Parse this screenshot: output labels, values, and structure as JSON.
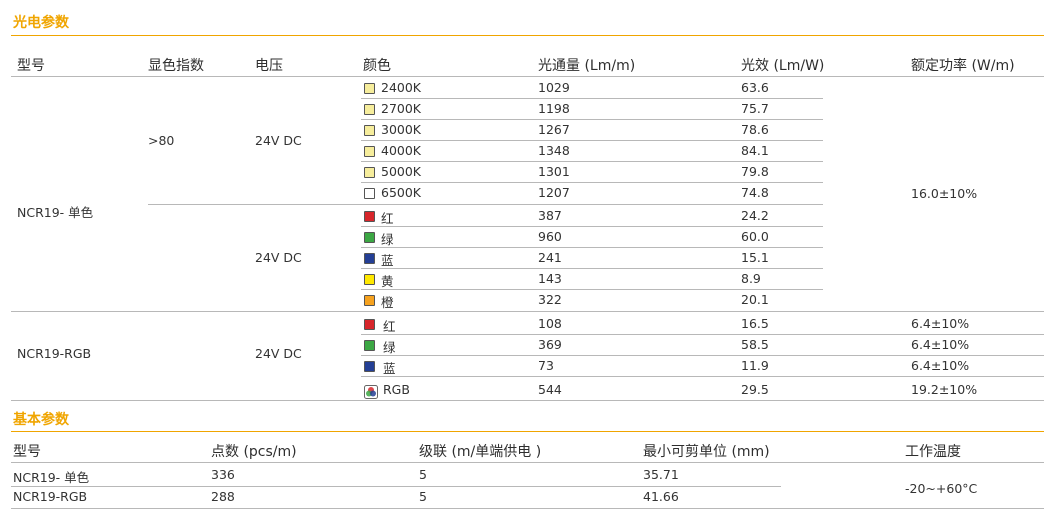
{
  "sections": {
    "optical": "光电参数",
    "basic": "基本参数"
  },
  "colors": {
    "accent": "#f0a500",
    "warm_white": "#f6ed9c",
    "cool_white": "#ffffff",
    "red": "#d7262b",
    "green": "#3ca744",
    "blue": "#243f95",
    "yellow": "#ffe800",
    "orange": "#f6a21e"
  },
  "optical_table": {
    "headers": [
      "型号",
      "显色指数",
      "电压",
      "颜色",
      "光通量 (Lm/m)",
      "光效 (Lm/W)",
      "额定功率 (W/m)"
    ],
    "mono": {
      "model": "NCR19- 单色",
      "cri": ">80",
      "voltage_white": "24V DC",
      "voltage_color": "24V DC",
      "power": "16.0±10%",
      "rows": [
        {
          "color": "2400K",
          "swatch": "warm_white",
          "flux": "1029",
          "efficacy": "63.6"
        },
        {
          "color": "2700K",
          "swatch": "warm_white",
          "flux": "1198",
          "efficacy": "75.7"
        },
        {
          "color": "3000K",
          "swatch": "warm_white",
          "flux": "1267",
          "efficacy": "78.6"
        },
        {
          "color": "4000K",
          "swatch": "warm_white",
          "flux": "1348",
          "efficacy": "84.1"
        },
        {
          "color": "5000K",
          "swatch": "warm_white",
          "flux": "1301",
          "efficacy": "79.8"
        },
        {
          "color": "6500K",
          "swatch": "cool_white",
          "flux": "1207",
          "efficacy": "74.8"
        },
        {
          "color": "红",
          "swatch": "red",
          "flux": "387",
          "efficacy": "24.2"
        },
        {
          "color": "绿",
          "swatch": "green",
          "flux": "960",
          "efficacy": "60.0"
        },
        {
          "color": "蓝",
          "swatch": "blue",
          "flux": "241",
          "efficacy": "15.1"
        },
        {
          "color": "黄",
          "swatch": "yellow",
          "flux": "143",
          "efficacy": "8.9"
        },
        {
          "color": "橙",
          "swatch": "orange",
          "flux": "322",
          "efficacy": "20.1"
        }
      ]
    },
    "rgb": {
      "model": "NCR19-RGB",
      "voltage": "24V DC",
      "rows": [
        {
          "color": "红",
          "swatch": "red",
          "flux": "108",
          "efficacy": "16.5",
          "power": "6.4±10%"
        },
        {
          "color": "绿",
          "swatch": "green",
          "flux": "369",
          "efficacy": "58.5",
          "power": "6.4±10%"
        },
        {
          "color": "蓝",
          "swatch": "blue",
          "flux": "73",
          "efficacy": "11.9",
          "power": "6.4±10%"
        },
        {
          "color": "RGB",
          "swatch": "rgb",
          "flux": "544",
          "efficacy": "29.5",
          "power": "19.2±10%"
        }
      ]
    }
  },
  "basic_table": {
    "headers": [
      "型号",
      "点数 (pcs/m)",
      "级联 (m/单端供电 )",
      "最小可剪单位 (mm)",
      "工作温度"
    ],
    "rows": [
      {
        "model": "NCR19- 单色",
        "points": "336",
        "cascade": "5",
        "min_cut": "35.71"
      },
      {
        "model": "NCR19-RGB",
        "points": "288",
        "cascade": "5",
        "min_cut": "41.66"
      }
    ],
    "temperature": "-20~+60°C"
  }
}
